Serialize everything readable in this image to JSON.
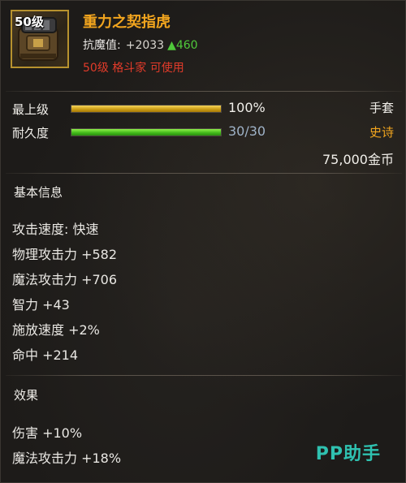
{
  "item": {
    "level_tag": "50级",
    "name": "重力之契指虎",
    "resist_label": "抗魔值:",
    "resist_value": "+2033",
    "resist_increase": "▲460",
    "requirement": "50级 格斗家 可使用",
    "icon": "gauntlet-icon"
  },
  "bars": {
    "grade_label": "最上级",
    "grade_value": "100%",
    "grade_fraction": 1.0,
    "durability_label": "耐久度",
    "durability_value": "30/30",
    "durability_fraction": 1.0
  },
  "meta": {
    "slot": "手套",
    "rarity": "史诗",
    "price": "75,000金币"
  },
  "basic": {
    "title": "基本信息",
    "stats": [
      "攻击速度: 快速",
      "物理攻击力 +582",
      "魔法攻击力 +706",
      "智力 +43",
      "施放速度 +2%",
      "命中 +214"
    ]
  },
  "effects": {
    "title": "效果",
    "stats": [
      "伤害 +10%",
      "魔法攻击力 +18%"
    ]
  },
  "watermark": "PP助手",
  "colors": {
    "name": "#f2a51e",
    "requirement": "#e23b2a",
    "increase": "#4fc93a",
    "grade_bar": "#d8a918",
    "durability_bar": "#47c21c",
    "watermark": "#2fc1b0"
  }
}
